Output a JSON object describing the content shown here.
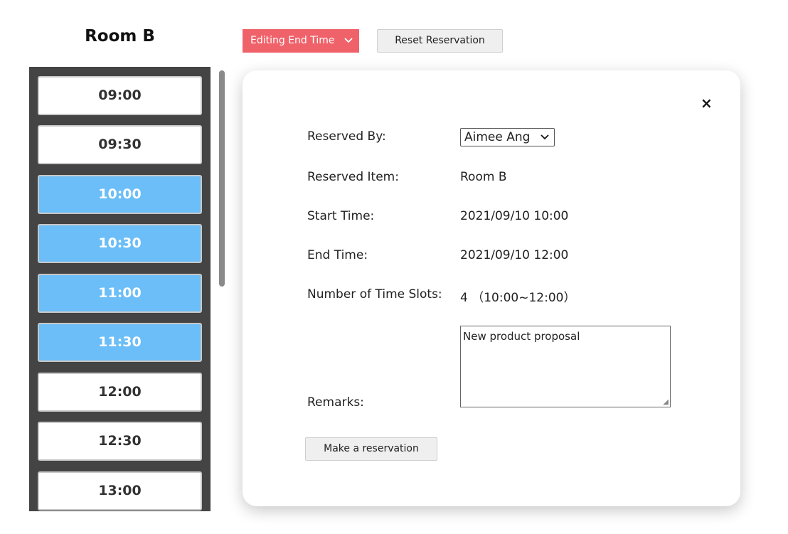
{
  "room_title": "Room B",
  "toolbar": {
    "mode_label": "Editing End Time",
    "reset_label": "Reset Reservation"
  },
  "slots": [
    {
      "time": "09:00",
      "selected": false
    },
    {
      "time": "09:30",
      "selected": false
    },
    {
      "time": "10:00",
      "selected": true
    },
    {
      "time": "10:30",
      "selected": true
    },
    {
      "time": "11:00",
      "selected": true
    },
    {
      "time": "11:30",
      "selected": true
    },
    {
      "time": "12:00",
      "selected": false
    },
    {
      "time": "12:30",
      "selected": false
    },
    {
      "time": "13:00",
      "selected": false
    }
  ],
  "modal": {
    "close_symbol": "×",
    "reserved_by_label": "Reserved By:",
    "reserved_by_value": "Aimee Ang",
    "reserved_item_label": "Reserved Item:",
    "reserved_item_value": "Room B",
    "start_time_label": "Start Time:",
    "start_time_value": "2021/09/10 10:00",
    "end_time_label": "End Time:",
    "end_time_value": "2021/09/10 12:00",
    "slots_label": "Number of Time Slots:",
    "slots_value": "4 （10:00~12:00）",
    "remarks_label": "Remarks:",
    "remarks_value": "New product proposal",
    "submit_label": "Make a reservation"
  },
  "colors": {
    "accent": "#f0626a",
    "selected_slot": "#6bbef7",
    "panel_bg": "#444444"
  },
  "icons": {
    "dropdown": "chevron-down-icon",
    "close": "close-icon"
  }
}
